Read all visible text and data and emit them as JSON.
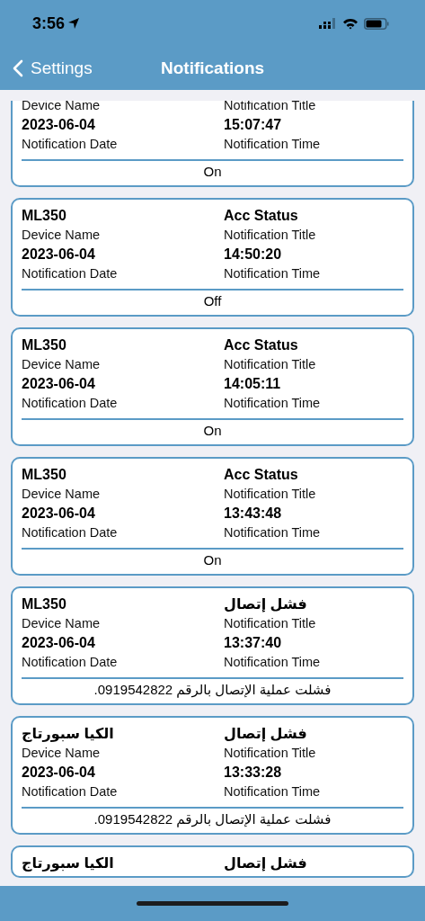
{
  "status_bar": {
    "time": "3:56"
  },
  "nav_bar": {
    "back_label": "Settings",
    "title": "Notifications"
  },
  "notifications": [
    {
      "date": "2023-06-04",
      "time": "15:07:47",
      "device_name_label": "Device Name",
      "title_label": "Notification Title",
      "date_label": "Notification Date",
      "time_label": "Notification Time",
      "message": "On"
    },
    {
      "device_name": "ML350",
      "title": "Acc Status",
      "device_name_label": "Device Name",
      "title_label": "Notification Title",
      "date": "2023-06-04",
      "time": "14:50:20",
      "date_label": "Notification Date",
      "time_label": "Notification Time",
      "message": "Off"
    },
    {
      "device_name": "ML350",
      "title": "Acc Status",
      "device_name_label": "Device Name",
      "title_label": "Notification Title",
      "date": "2023-06-04",
      "time": "14:05:11",
      "date_label": "Notification Date",
      "time_label": "Notification Time",
      "message": "On"
    },
    {
      "device_name": "ML350",
      "title": "Acc Status",
      "device_name_label": "Device Name",
      "title_label": "Notification Title",
      "date": "2023-06-04",
      "time": "13:43:48",
      "date_label": "Notification Date",
      "time_label": "Notification Time",
      "message": "On"
    },
    {
      "device_name": "ML350",
      "title": "فشل إتصال",
      "device_name_label": "Device Name",
      "title_label": "Notification Title",
      "date": "2023-06-04",
      "time": "13:37:40",
      "date_label": "Notification Date",
      "time_label": "Notification Time",
      "message": "فشلت عملية الإتصال بالرقم 0919542822."
    },
    {
      "device_name": "الكيا سبورتاج",
      "title": "فشل إتصال",
      "device_name_label": "Device Name",
      "title_label": "Notification Title",
      "date": "2023-06-04",
      "time": "13:33:28",
      "date_label": "Notification Date",
      "time_label": "Notification Time",
      "message": "فشلت عملية الإتصال بالرقم 0919542822."
    },
    {
      "device_name": "الكيا سبورتاج",
      "title": "فشل إتصال"
    }
  ]
}
